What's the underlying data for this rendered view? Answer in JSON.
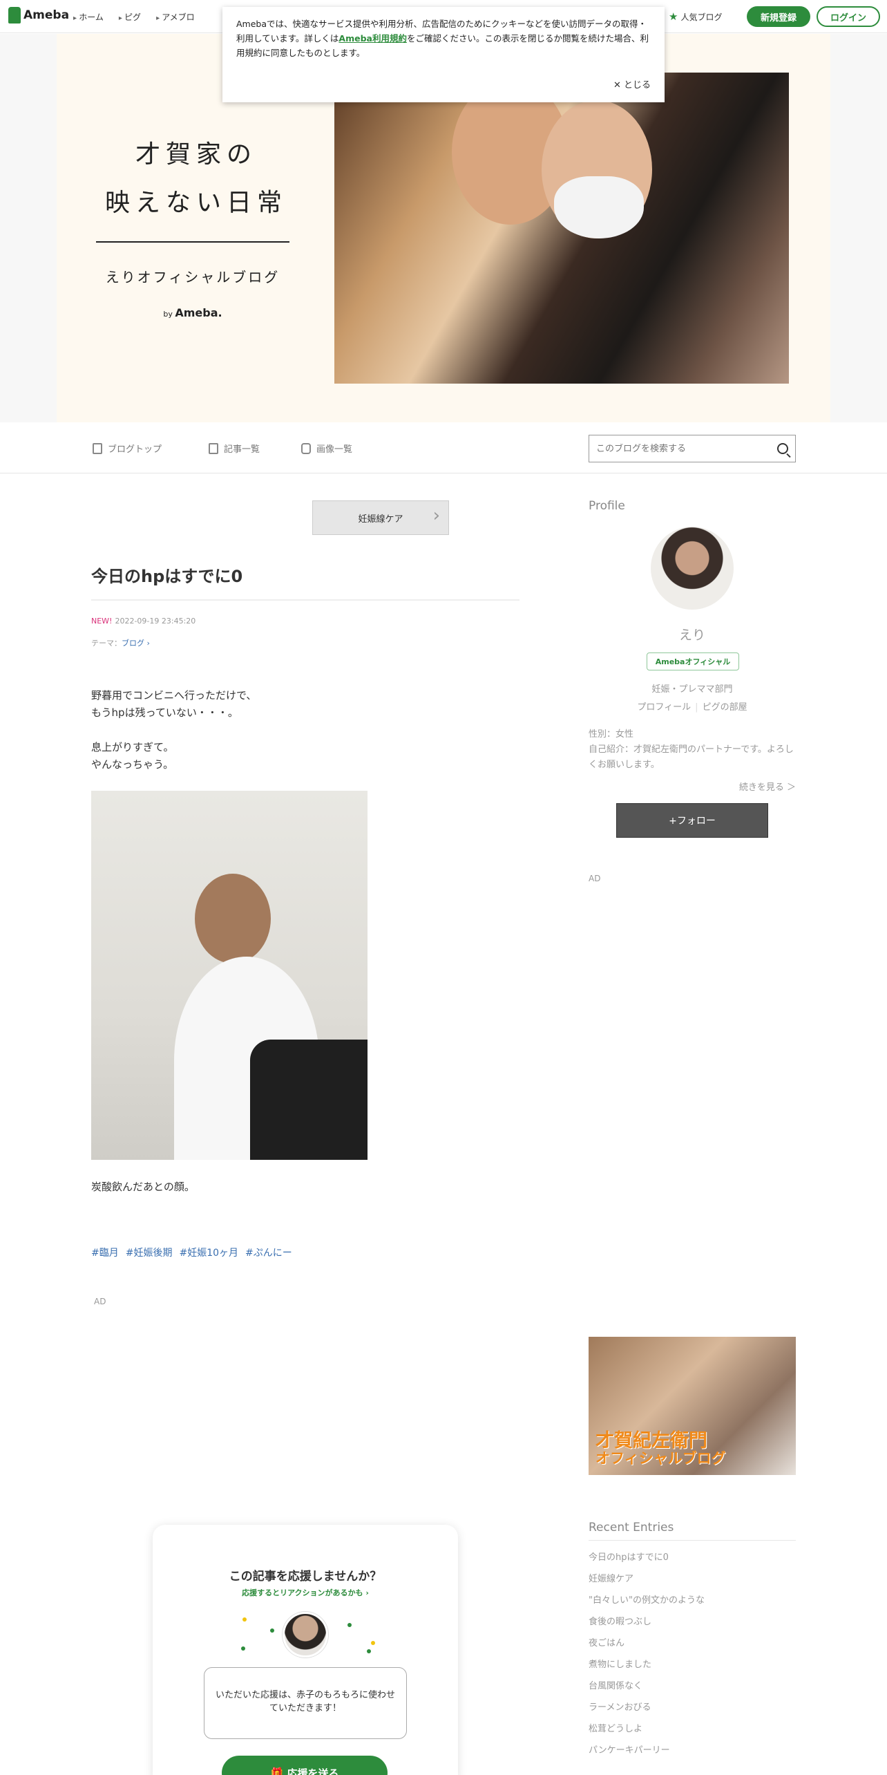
{
  "topbar": {
    "logo": "Ameba",
    "nav": [
      "ホーム",
      "ピグ",
      "アメブロ"
    ],
    "popular": "人気ブログ",
    "register": "新規登録",
    "login": "ログイン"
  },
  "cookie": {
    "text_1": "Amebaでは、快適なサービス提供や利用分析、広告配信のためにクッキーなどを使い訪問データの取得・利用しています。詳しくは",
    "link": "Ameba利用規約",
    "text_2": "をご確認ください。この表示を閉じるか閲覧を続けた場合、利用規約に同意したものとします。",
    "close": "✕ とじる"
  },
  "header": {
    "title_line1": "才賀家の",
    "title_line2": "映えない日常",
    "subtitle": "えりオフィシャルブログ",
    "by": "by",
    "brand": "Ameba."
  },
  "blognav": {
    "top": "ブログトップ",
    "list": "記事一覧",
    "images": "画像一覧",
    "search_placeholder": "このブログを検索する"
  },
  "article": {
    "category_button": "妊娠線ケア",
    "title": "今日のhpはすでに0",
    "new_label": "NEW!",
    "date": "2022-09-19 23:45:20",
    "theme_label": "テーマ：",
    "theme": "ブログ ›",
    "p1_l1": "野暮用でコンビニへ行っただけで、",
    "p1_l2": "もうhpは残っていない・・・。",
    "p2_l1": "息上がりすぎて。",
    "p2_l2": "やんなっちゃう。",
    "caption": "炭酸飲んだあとの顔。",
    "tags": [
      "#臨月",
      "#妊娠後期",
      "#妊娠10ヶ月",
      "#ぷんにー"
    ],
    "ad": "AD"
  },
  "support": {
    "title": "この記事を応援しませんか？",
    "subtitle": "応援するとリアクションがあるかも ›",
    "message": "いただいた応援は、赤子のもろもろに使わせていただきます！",
    "button": "応援を送る"
  },
  "sidebar": {
    "profile_heading": "Profile",
    "name": "えり",
    "badge": "Amebaオフィシャル",
    "category": "妊娠・プレママ部門",
    "profile_link": "プロフィール",
    "pig_link": "ピグの部屋",
    "gender": "性別：女性",
    "intro": "自己紹介：才賀紀左衛門のパートナーです。よろしくお願いします。",
    "more": "続きを見る ＞",
    "follow": "+フォロー",
    "ad": "AD",
    "banner_line1": "才賀紀左衛門",
    "banner_line2": "オフィシャルブログ",
    "recent_heading": "Recent Entries",
    "recent": [
      "今日のhpはすでに0",
      "妊娠線ケア",
      "\"白々しい\"の例文かのような",
      "食後の暇つぶし",
      "夜ごはん",
      "煮物にしました",
      "台風関係なく",
      "ラーメンおびる",
      "松茸どうしよ",
      "パンケーキパーリー"
    ]
  },
  "colors": {
    "brand_green": "#2d8c3c",
    "new_pink": "#d9327a",
    "link_blue": "#3a6fb0"
  }
}
